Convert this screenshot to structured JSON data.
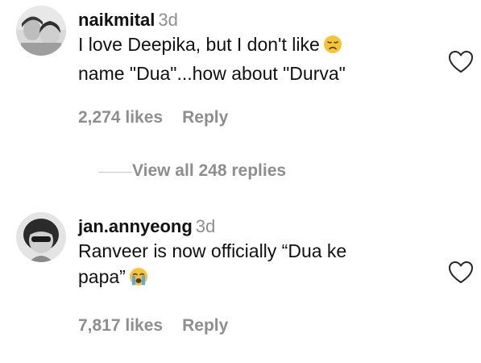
{
  "comments": [
    {
      "username": "naikmital",
      "time": "3d",
      "text_lines": [
        "I love Deepika, but I don't like",
        "name \"Dua\"...how about \"Durva\""
      ],
      "emoji": "disappointed-face",
      "likes": "2,274 likes",
      "reply_label": "Reply"
    },
    {
      "username": "jan.annyeong",
      "time": "3d",
      "text_lines": [
        "Ranveer is now officially “Dua ke",
        "papa”"
      ],
      "emoji": "loudly-crying-face",
      "likes": "7,817 likes",
      "reply_label": "Reply"
    }
  ],
  "view_replies_label": "View all 248 replies",
  "icons": {
    "like": "heart-outline-icon"
  },
  "colors": {
    "text": "#111111",
    "muted": "#8e8e8e",
    "divider": "#c7c7c7",
    "emoji_yellow": "#f7c531"
  }
}
